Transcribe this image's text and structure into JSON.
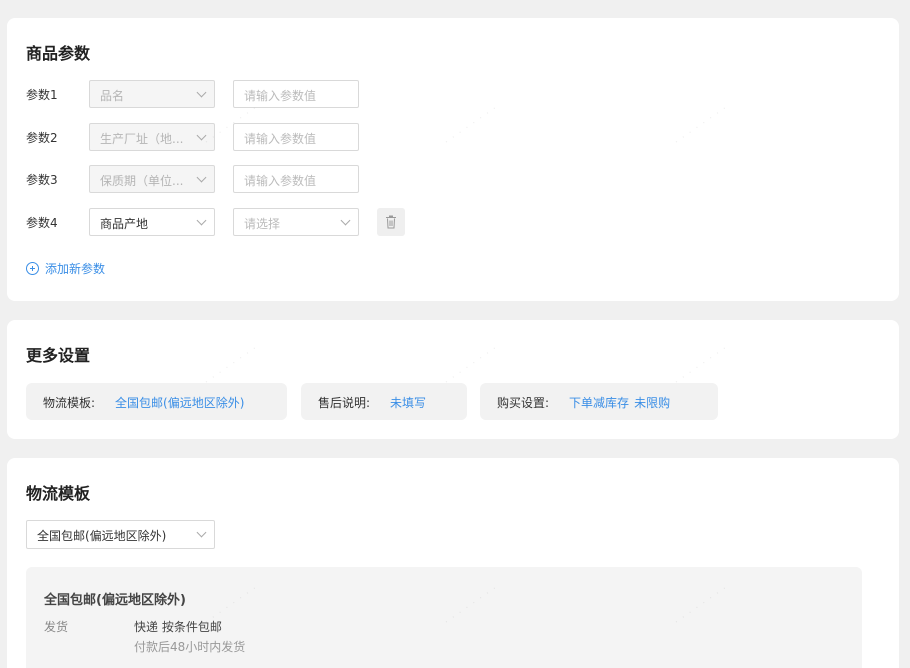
{
  "params_card": {
    "title": "商品参数",
    "rows": [
      {
        "label": "参数1",
        "name": "品名",
        "value_placeholder": "请输入参数值"
      },
      {
        "label": "参数2",
        "name": "生产厂址（地...",
        "value_placeholder": "请输入参数值"
      },
      {
        "label": "参数3",
        "name": "保质期（单位...",
        "value_placeholder": "请输入参数值"
      },
      {
        "label": "参数4",
        "name": "商品产地",
        "value_placeholder": "请选择"
      }
    ],
    "add_label": "添加新参数"
  },
  "more_card": {
    "title": "更多设置",
    "logistics_key": "物流模板:",
    "logistics_value": "全国包邮(偏远地区除外)",
    "aftersale_key": "售后说明:",
    "aftersale_value": "未填写",
    "purchase_key": "购买设置:",
    "purchase_value_1": "下单减库存",
    "purchase_value_2": "未限购"
  },
  "logistics_card": {
    "title": "物流模板",
    "selected": "全国包邮(偏远地区除外)",
    "template_name": "全国包邮(偏远地区除外)",
    "ship_key": "发货",
    "ship_method": "快递 按条件包邮",
    "ship_time": "付款后48小时内发货"
  },
  "colors": {
    "accent": "#3a8ee6",
    "background": "#f0f0f0"
  },
  "icons": {
    "delete": "trash-icon",
    "add": "plus-circle-icon",
    "dropdown": "chevron-down-icon"
  }
}
